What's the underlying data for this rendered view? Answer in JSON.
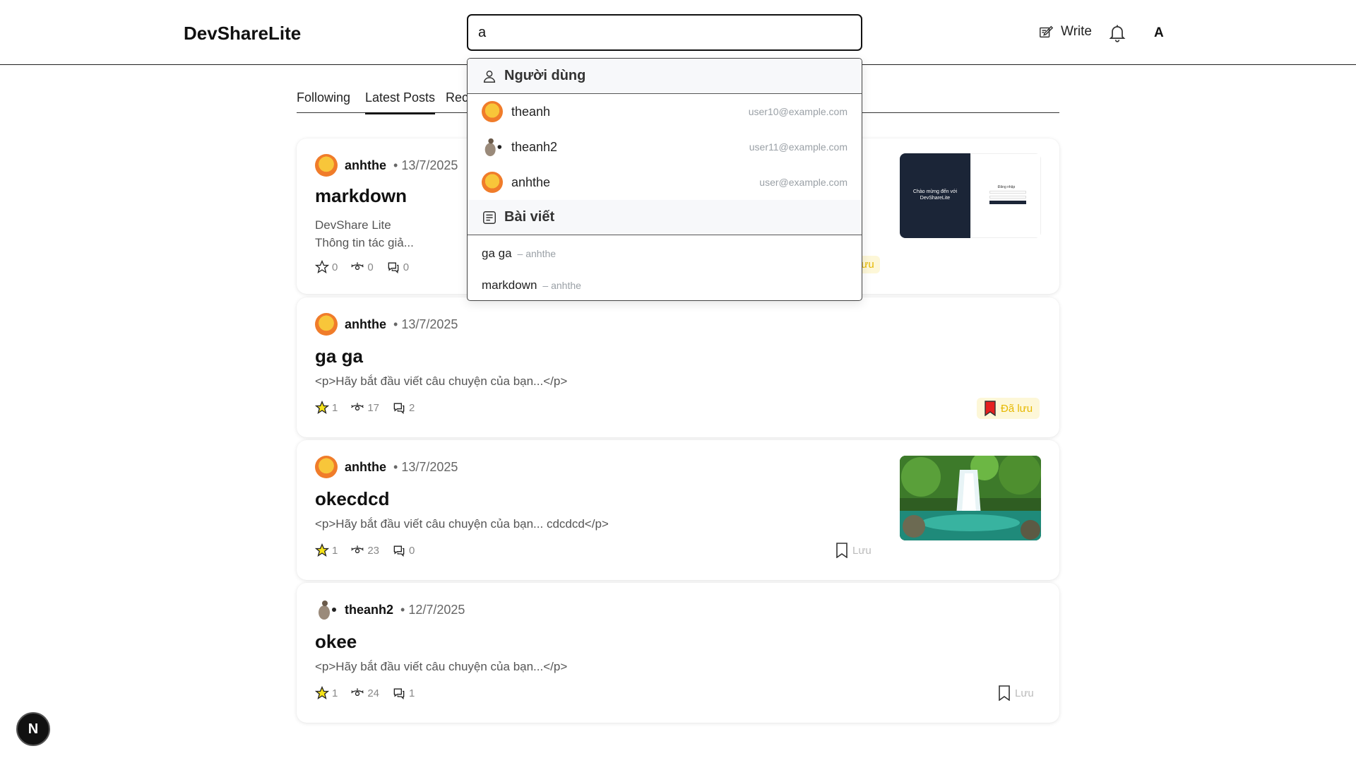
{
  "header": {
    "logo": "DevShareLite",
    "search_value": "a",
    "write_label": "Write",
    "avatar_letter": "A"
  },
  "tabs": [
    {
      "label": "Following"
    },
    {
      "label": "Latest Posts"
    },
    {
      "label": "Rec"
    }
  ],
  "dropdown": {
    "users_heading": "Người dùng",
    "users": [
      {
        "name": "theanh",
        "email": "user10@example.com"
      },
      {
        "name": "theanh2",
        "email": "user11@example.com"
      },
      {
        "name": "anhthe",
        "email": "user@example.com"
      }
    ],
    "posts_heading": "Bài viết",
    "posts": [
      {
        "title": "ga ga",
        "author": "– anhthe"
      },
      {
        "title": "markdown",
        "author": "– anhthe"
      }
    ]
  },
  "posts": [
    {
      "author": "anhthe",
      "date": "• 13/7/2025",
      "title": "markdown",
      "excerpt_line1": "DevShare Lite",
      "excerpt_line2": "Thông tin tác giả...",
      "stars": "0",
      "views": "0",
      "comments": "0",
      "save_label": "lưu"
    },
    {
      "author": "anhthe",
      "date": "• 13/7/2025",
      "title": "ga ga",
      "excerpt_line1": "<p>Hãy bắt đầu viết câu chuyện của bạn...</p>",
      "stars": "1",
      "views": "17",
      "comments": "2",
      "save_label": "Đã lưu"
    },
    {
      "author": "anhthe",
      "date": "• 13/7/2025",
      "title": "okecdcd",
      "excerpt_line1": "<p>Hãy bắt đầu viết câu chuyện của bạn... cdcdcd</p>",
      "stars": "1",
      "views": "23",
      "comments": "0",
      "save_label": "Lưu"
    },
    {
      "author": "theanh2",
      "date": "• 12/7/2025",
      "title": "okee",
      "excerpt_line1": "<p>Hãy bắt đầu viết câu chuyện của bạn...</p>",
      "stars": "1",
      "views": "24",
      "comments": "1",
      "save_label": "Lưu"
    }
  ],
  "thumb1": {
    "heading": "Chào mừng đến với DevShareLite",
    "panel": "Đăng nhập"
  },
  "next_badge": "N",
  "colors": {
    "star_filled": "#f5e31a",
    "saved_flag": "#e52020",
    "saved_text": "#e6b800"
  }
}
